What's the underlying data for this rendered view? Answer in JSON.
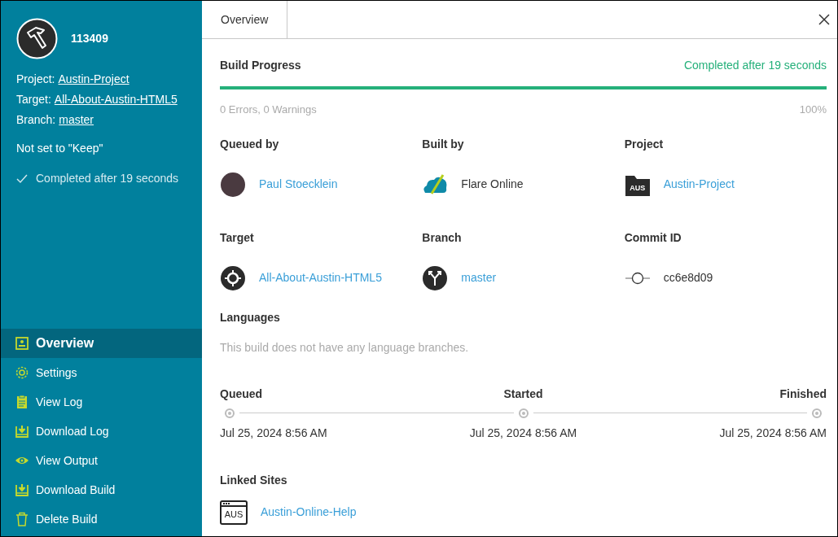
{
  "build": {
    "number": "113409",
    "details": [
      {
        "label": "Project:",
        "value": "Austin-Project"
      },
      {
        "label": "Target:",
        "value": "All-About-Austin-HTML5"
      },
      {
        "label": "Branch:",
        "value": "master"
      }
    ],
    "keep_status": "Not set to \"Keep\"",
    "status": "Completed after 19 seconds"
  },
  "nav": [
    {
      "label": "Overview",
      "kind": "overview",
      "selected": true
    },
    {
      "label": "Settings",
      "kind": "settings",
      "selected": false
    },
    {
      "label": "View Log",
      "kind": "log",
      "selected": false
    },
    {
      "label": "Download Log",
      "kind": "download",
      "selected": false
    },
    {
      "label": "View Output",
      "kind": "output",
      "selected": false
    },
    {
      "label": "Download Build",
      "kind": "download",
      "selected": false
    },
    {
      "label": "Delete Build",
      "kind": "delete",
      "selected": false
    }
  ],
  "tabs": [
    {
      "label": "Overview",
      "selected": true
    }
  ],
  "progress": {
    "title": "Build Progress",
    "status": "Completed after 19 seconds",
    "level": 1,
    "issues": "0 Errors, 0 Warnings",
    "percent": "100%"
  },
  "fields": [
    {
      "label": "Queued by",
      "value": "Paul Stoecklein",
      "kind": "user",
      "link": true
    },
    {
      "label": "Built by",
      "value": "Flare Online",
      "kind": "builder",
      "link": false
    },
    {
      "label": "Project",
      "value": "Austin-Project",
      "kind": "project",
      "icon_text": "AUS",
      "link": true
    },
    {
      "label": "Target",
      "value": "All-About-Austin-HTML5",
      "kind": "target",
      "link": true
    },
    {
      "label": "Branch",
      "value": "master",
      "kind": "branch",
      "link": true
    },
    {
      "label": "Commit ID",
      "value": "cc6e8d09",
      "kind": "commit",
      "link": false
    }
  ],
  "languages": {
    "title": "Languages",
    "message": "This build does not have any language branches."
  },
  "timeline": [
    {
      "label": "Queued",
      "time": "Jul 25, 2024 8:56 AM"
    },
    {
      "label": "Started",
      "time": "Jul 25, 2024 8:56 AM"
    },
    {
      "label": "Finished",
      "time": "Jul 25, 2024 8:56 AM"
    }
  ],
  "linked_sites": {
    "title": "Linked Sites",
    "items": [
      {
        "name": "Austin-Online-Help",
        "icon_text": "AUS"
      }
    ]
  }
}
